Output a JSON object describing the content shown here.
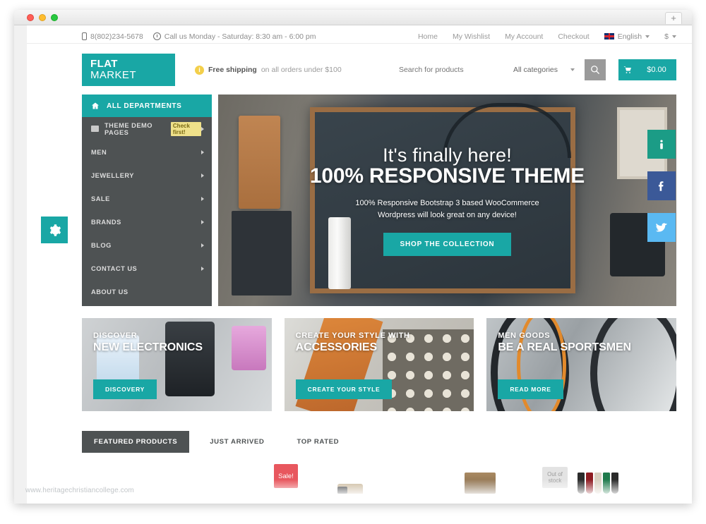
{
  "browser": {
    "new_tab_label": "+",
    "traffic_lights": [
      "close",
      "minimize",
      "zoom"
    ]
  },
  "topbar": {
    "phone": "8(802)234-5678",
    "hours": "Call us Monday - Saturday: 8:30 am - 6:00 pm",
    "links": [
      {
        "label": "Home"
      },
      {
        "label": "My Wishlist"
      },
      {
        "label": "My Account"
      },
      {
        "label": "Checkout"
      }
    ],
    "language": "English",
    "currency": "$"
  },
  "header": {
    "logo_line1": "FLAT",
    "logo_line2": "MARKET",
    "free_shipping_strong": "Free shipping",
    "free_shipping_rest": "on all orders under $100",
    "search_placeholder": "Search for products",
    "search_value": "",
    "category_selected": "All categories",
    "cart_total": "$0.00"
  },
  "sidebar": {
    "header_label": "ALL DEPARTMENTS",
    "items": [
      {
        "label": "THEME DEMO PAGES",
        "badge": "Check first!",
        "has_icon": true,
        "has_arrow": true
      },
      {
        "label": "MEN",
        "badge": "",
        "has_icon": false,
        "has_arrow": true
      },
      {
        "label": "JEWELLERY",
        "badge": "",
        "has_icon": false,
        "has_arrow": true
      },
      {
        "label": "SALE",
        "badge": "",
        "has_icon": false,
        "has_arrow": true
      },
      {
        "label": "BRANDS",
        "badge": "",
        "has_icon": false,
        "has_arrow": true
      },
      {
        "label": "BLOG",
        "badge": "",
        "has_icon": false,
        "has_arrow": true
      },
      {
        "label": "CONTACT US",
        "badge": "",
        "has_icon": false,
        "has_arrow": true
      },
      {
        "label": "ABOUT US",
        "badge": "",
        "has_icon": false,
        "has_arrow": false
      }
    ]
  },
  "hero": {
    "title_small": "It's finally here!",
    "title_big": "100% RESPONSIVE THEME",
    "subtitle_line1": "100% Responsive Bootstrap 3 based WooCommerce",
    "subtitle_line2": "Wordpress will look great on any device!",
    "cta_label": "SHOP THE COLLECTION"
  },
  "promos": [
    {
      "sub": "DISCOVER",
      "title": "NEW ELECTRONICS",
      "button": "DISCOVERY"
    },
    {
      "sub": "CREATE YOUR STYLE WITH",
      "title": "ACCESSORIES",
      "button": "CREATE YOUR STYLE"
    },
    {
      "sub": "MEN GOODS",
      "title": "BE A REAL SPORTSMEN",
      "button": "READ MORE"
    }
  ],
  "tabs": [
    {
      "label": "FEATURED PRODUCTS",
      "active": true
    },
    {
      "label": "JUST ARRIVED",
      "active": false
    },
    {
      "label": "TOP RATED",
      "active": false
    }
  ],
  "product_strip": {
    "sale_badge": "Sale!",
    "out_of_stock_badge": "Out of stock"
  },
  "social": [
    {
      "name": "info-icon",
      "glyph": "i",
      "color": "#1b9c86"
    },
    {
      "name": "facebook-icon",
      "glyph": "f",
      "color": "#3b5998"
    },
    {
      "name": "twitter-icon",
      "glyph": "bird",
      "color": "#5ab9f2"
    }
  ],
  "settings_tab": {
    "icon": "gear-icon"
  },
  "watermark": "www.heritagechristiancollege.com",
  "colors": {
    "accent_teal": "#19a7a5",
    "sidebar_dark": "#4e5253",
    "sale_red": "#e8575e",
    "badge_yellow": "#efe18a"
  }
}
